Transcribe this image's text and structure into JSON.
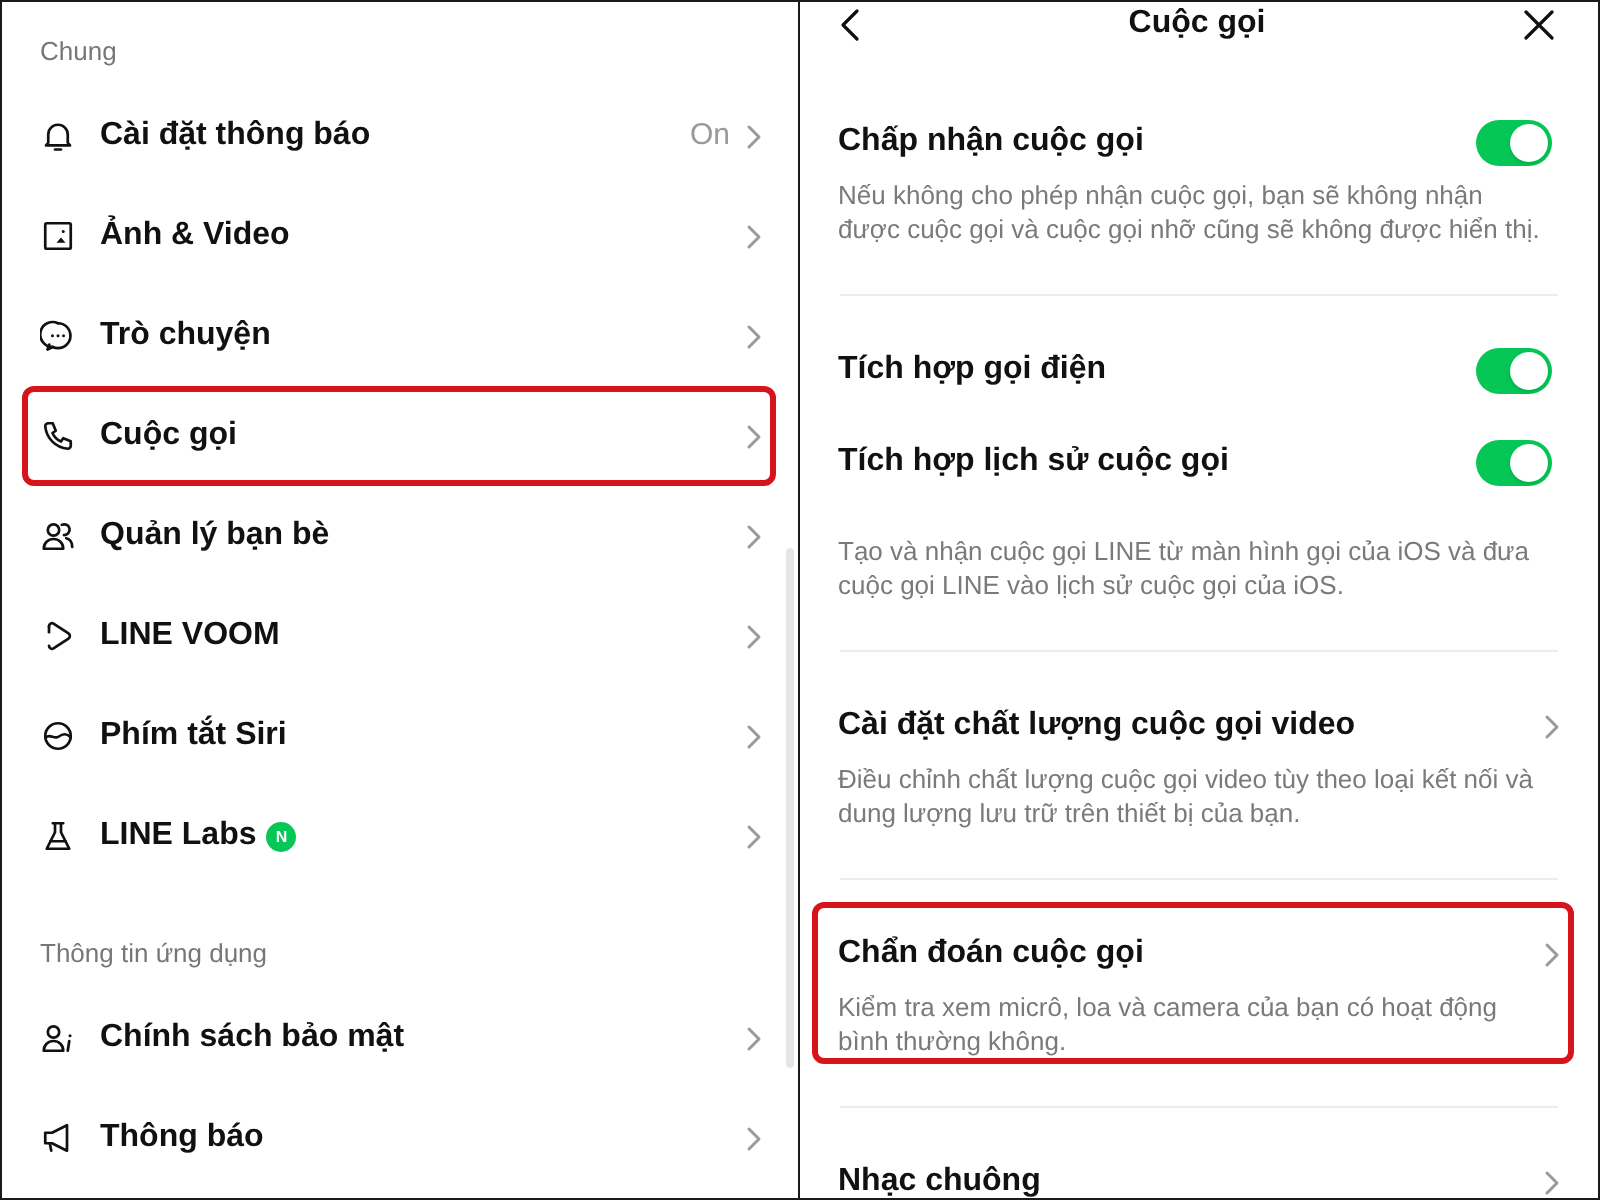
{
  "settings_menu": {
    "sections": [
      {
        "header": "Chung",
        "items": [
          {
            "label": "Cài đặt thông báo",
            "value": "On",
            "highlighted": false
          },
          {
            "label": "Ảnh & Video",
            "highlighted": false
          },
          {
            "label": "Trò chuyện",
            "highlighted": false
          },
          {
            "label": "Cuộc gọi",
            "highlighted": true
          },
          {
            "label": "Quản lý bạn bè",
            "highlighted": false
          },
          {
            "label": "LINE VOOM",
            "highlighted": false
          },
          {
            "label": "Phím tắt Siri",
            "highlighted": false
          },
          {
            "label": "LINE Labs",
            "badge": "N",
            "highlighted": false
          }
        ]
      },
      {
        "header": "Thông tin ứng dụng",
        "items": [
          {
            "label": "Chính sách bảo mật",
            "highlighted": false
          },
          {
            "label": "Thông báo",
            "highlighted": false
          }
        ]
      }
    ]
  },
  "call_settings": {
    "header": {
      "title": "Cuộc gọi"
    },
    "groups": [
      {
        "highlighted": false,
        "rows": [
          {
            "kind": "toggle",
            "label": "Chấp nhận cuộc gọi",
            "on": true,
            "description": "Nếu không cho phép nhận cuộc gọi, bạn sẽ không nhận được cuộc gọi và cuộc gọi nhỡ cũng sẽ không được hiển thị."
          }
        ]
      },
      {
        "highlighted": false,
        "rows": [
          {
            "kind": "toggle",
            "label": "Tích hợp gọi điện",
            "on": true
          },
          {
            "kind": "toggle",
            "label": "Tích hợp lịch sử cuộc gọi",
            "on": true
          }
        ],
        "note": "Tạo và nhận cuộc gọi LINE từ màn hình gọi của iOS và đưa cuộc gọi LINE vào lịch sử cuộc gọi của iOS."
      },
      {
        "highlighted": false,
        "rows": [
          {
            "kind": "link",
            "label": "Cài đặt chất lượng cuộc gọi video",
            "description": "Điều chỉnh chất lượng cuộc gọi video tùy theo loại kết nối và dung lượng lưu trữ trên thiết bị của bạn."
          }
        ]
      },
      {
        "highlighted": true,
        "rows": [
          {
            "kind": "link",
            "label": "Chẩn đoán cuộc gọi",
            "description": "Kiểm tra xem micrô, loa và camera của bạn có hoạt động bình thường không."
          }
        ]
      },
      {
        "highlighted": false,
        "rows": [
          {
            "kind": "link",
            "label": "Nhạc chuông"
          }
        ]
      }
    ]
  }
}
